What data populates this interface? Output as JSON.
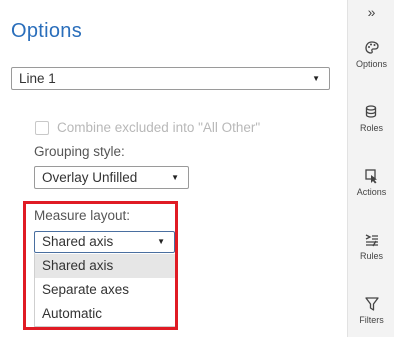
{
  "panel": {
    "title": "Options",
    "object_select": "Line 1",
    "combine_label": "Combine excluded into \"All Other\"",
    "grouping_label": "Grouping style:",
    "grouping_value": "Overlay Unfilled",
    "measure_label": "Measure layout:",
    "measure_value": "Shared axis",
    "measure_options": [
      "Shared axis",
      "Separate axes",
      "Automatic"
    ]
  },
  "sidebar": {
    "collapse": "»",
    "items": [
      {
        "label": "Options",
        "icon": "palette-icon"
      },
      {
        "label": "Roles",
        "icon": "roles-icon"
      },
      {
        "label": "Actions",
        "icon": "actions-icon"
      },
      {
        "label": "Rules",
        "icon": "rules-icon"
      },
      {
        "label": "Filters",
        "icon": "filter-icon"
      }
    ]
  },
  "colors": {
    "title": "#2a6ebb",
    "highlight": "#e01b24",
    "selected_option": "#e6e6e6"
  }
}
